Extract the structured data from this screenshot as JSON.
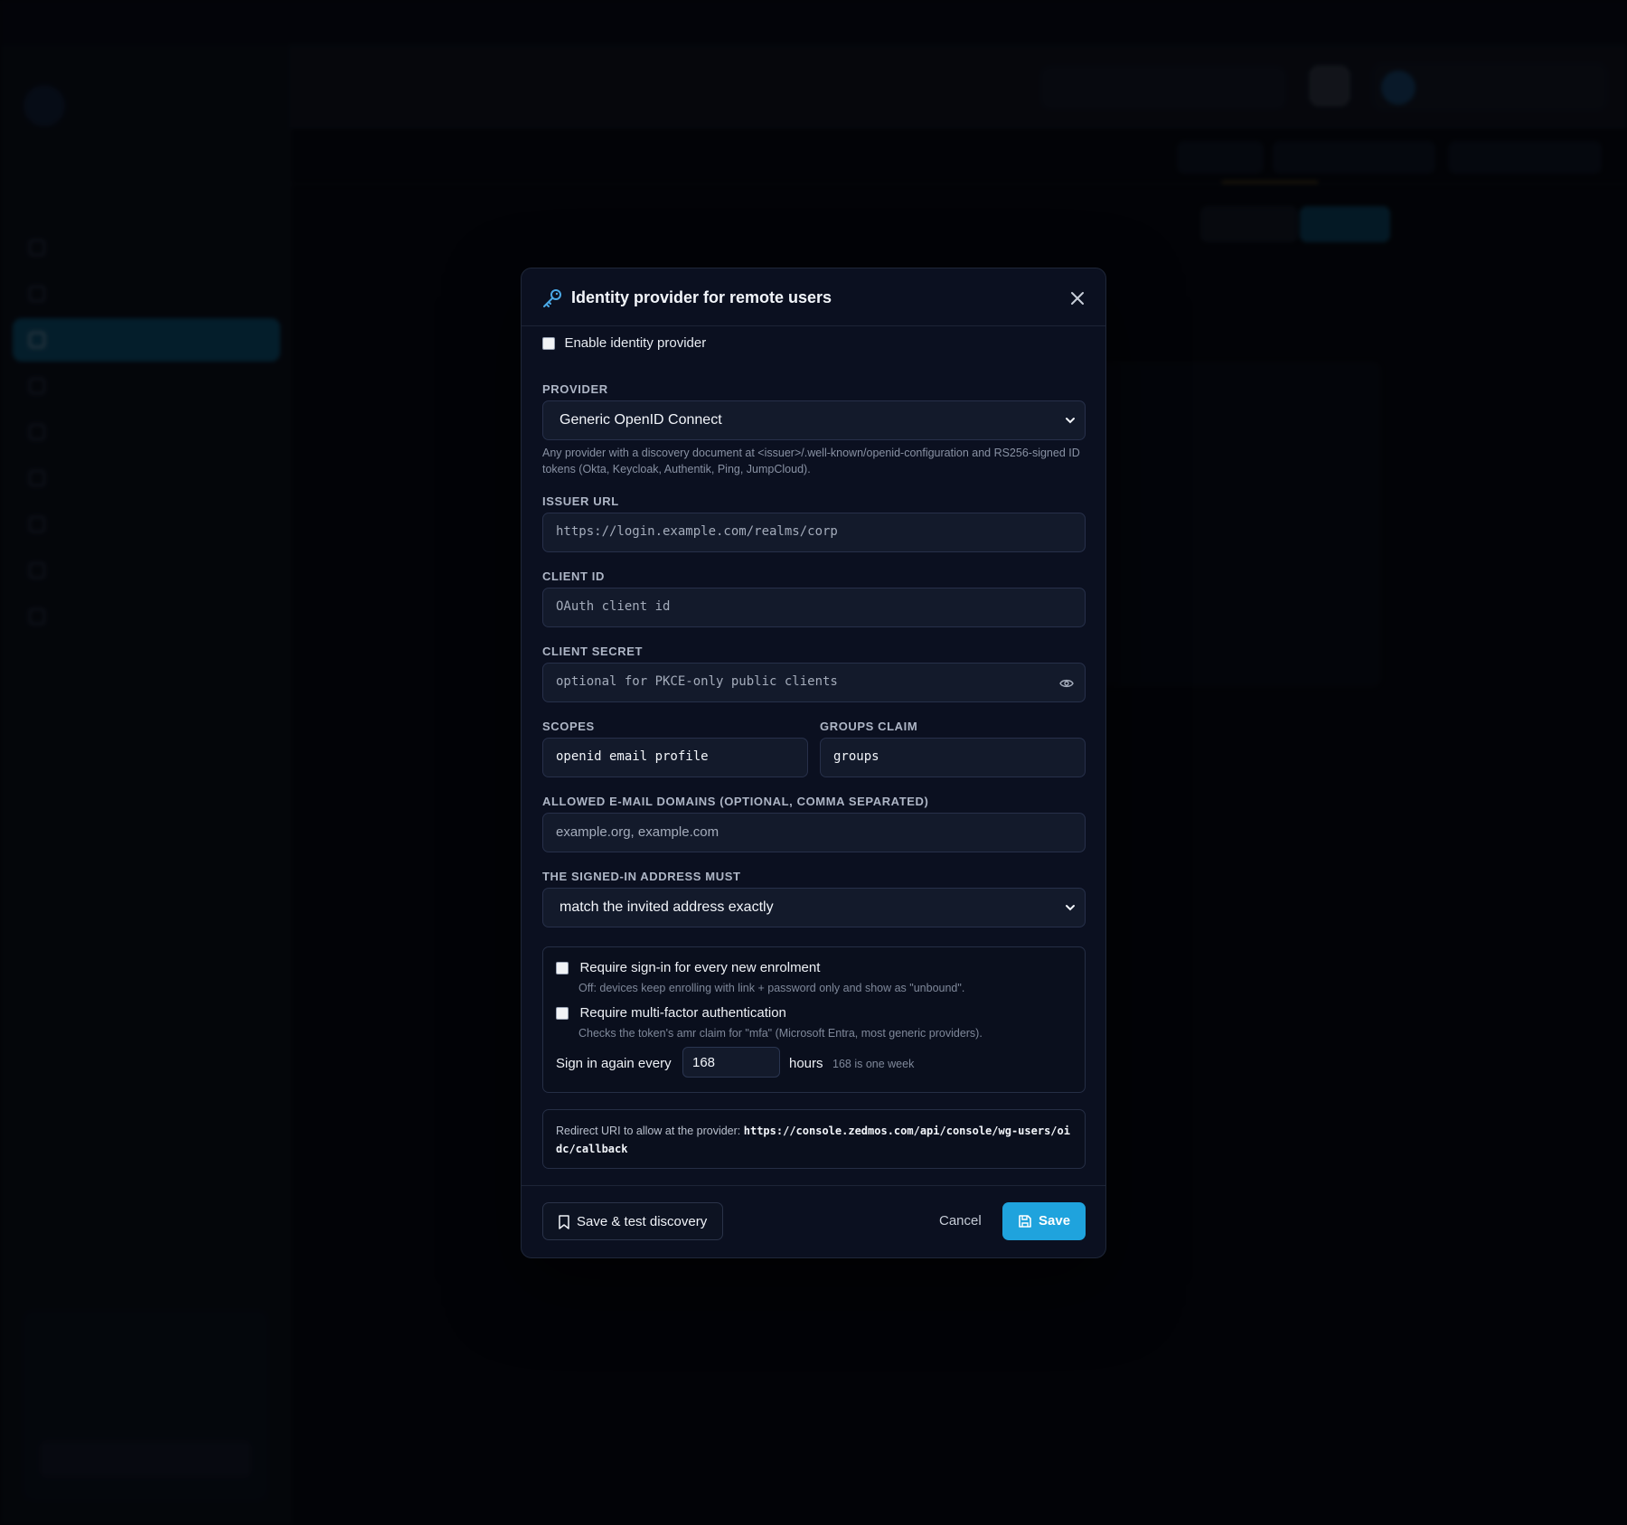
{
  "modal": {
    "title": "Identity provider for remote users",
    "enable_label": "Enable identity provider",
    "provider": {
      "label": "PROVIDER",
      "value": "Generic OpenID Connect",
      "help": "Any provider with a discovery document at <issuer>/.well-known/openid-configuration and RS256-signed ID tokens (Okta, Keycloak, Authentik, Ping, JumpCloud)."
    },
    "issuer_url": {
      "label": "ISSUER URL",
      "value": "https://login.example.com/realms/corp"
    },
    "client_id": {
      "label": "CLIENT ID",
      "placeholder": "OAuth client id"
    },
    "client_secret": {
      "label": "CLIENT SECRET",
      "placeholder": "optional for PKCE-only public clients"
    },
    "scopes": {
      "label": "SCOPES",
      "value": "openid email profile"
    },
    "groups_claim": {
      "label": "GROUPS CLAIM",
      "value": "groups"
    },
    "allowed_domains": {
      "label": "ALLOWED E-MAIL DOMAINS (OPTIONAL, COMMA SEPARATED)",
      "placeholder": "example.org, example.com"
    },
    "address_rule": {
      "label": "THE SIGNED-IN ADDRESS MUST",
      "value": "match the invited address exactly"
    },
    "require_signin": {
      "title": "Require sign-in for every new enrolment",
      "sub": "Off: devices keep enrolling with link + password only and show as \"unbound\"."
    },
    "require_mfa": {
      "title": "Require multi-factor authentication",
      "sub": "Checks the token's amr claim for \"mfa\" (Microsoft Entra, most generic providers)."
    },
    "reauth": {
      "label": "Sign in again every",
      "value": "168",
      "unit": "hours",
      "note": "168 is one week"
    },
    "redirect": {
      "label": "Redirect URI to allow at the provider:",
      "uri": "https://console.zedmos.com/api/console/wg-users/oidc/callback"
    },
    "footer": {
      "test_label": "Save & test discovery",
      "cancel_label": "Cancel",
      "save_label": "Save"
    }
  },
  "colors": {
    "accent": "#1fa3dd",
    "modal_bg": "#0b1020",
    "field_bg": "#131a2b"
  },
  "icons": [
    "key-icon",
    "close-icon",
    "chevron-down-icon",
    "eye-icon",
    "bookmark-icon",
    "save-icon"
  ]
}
